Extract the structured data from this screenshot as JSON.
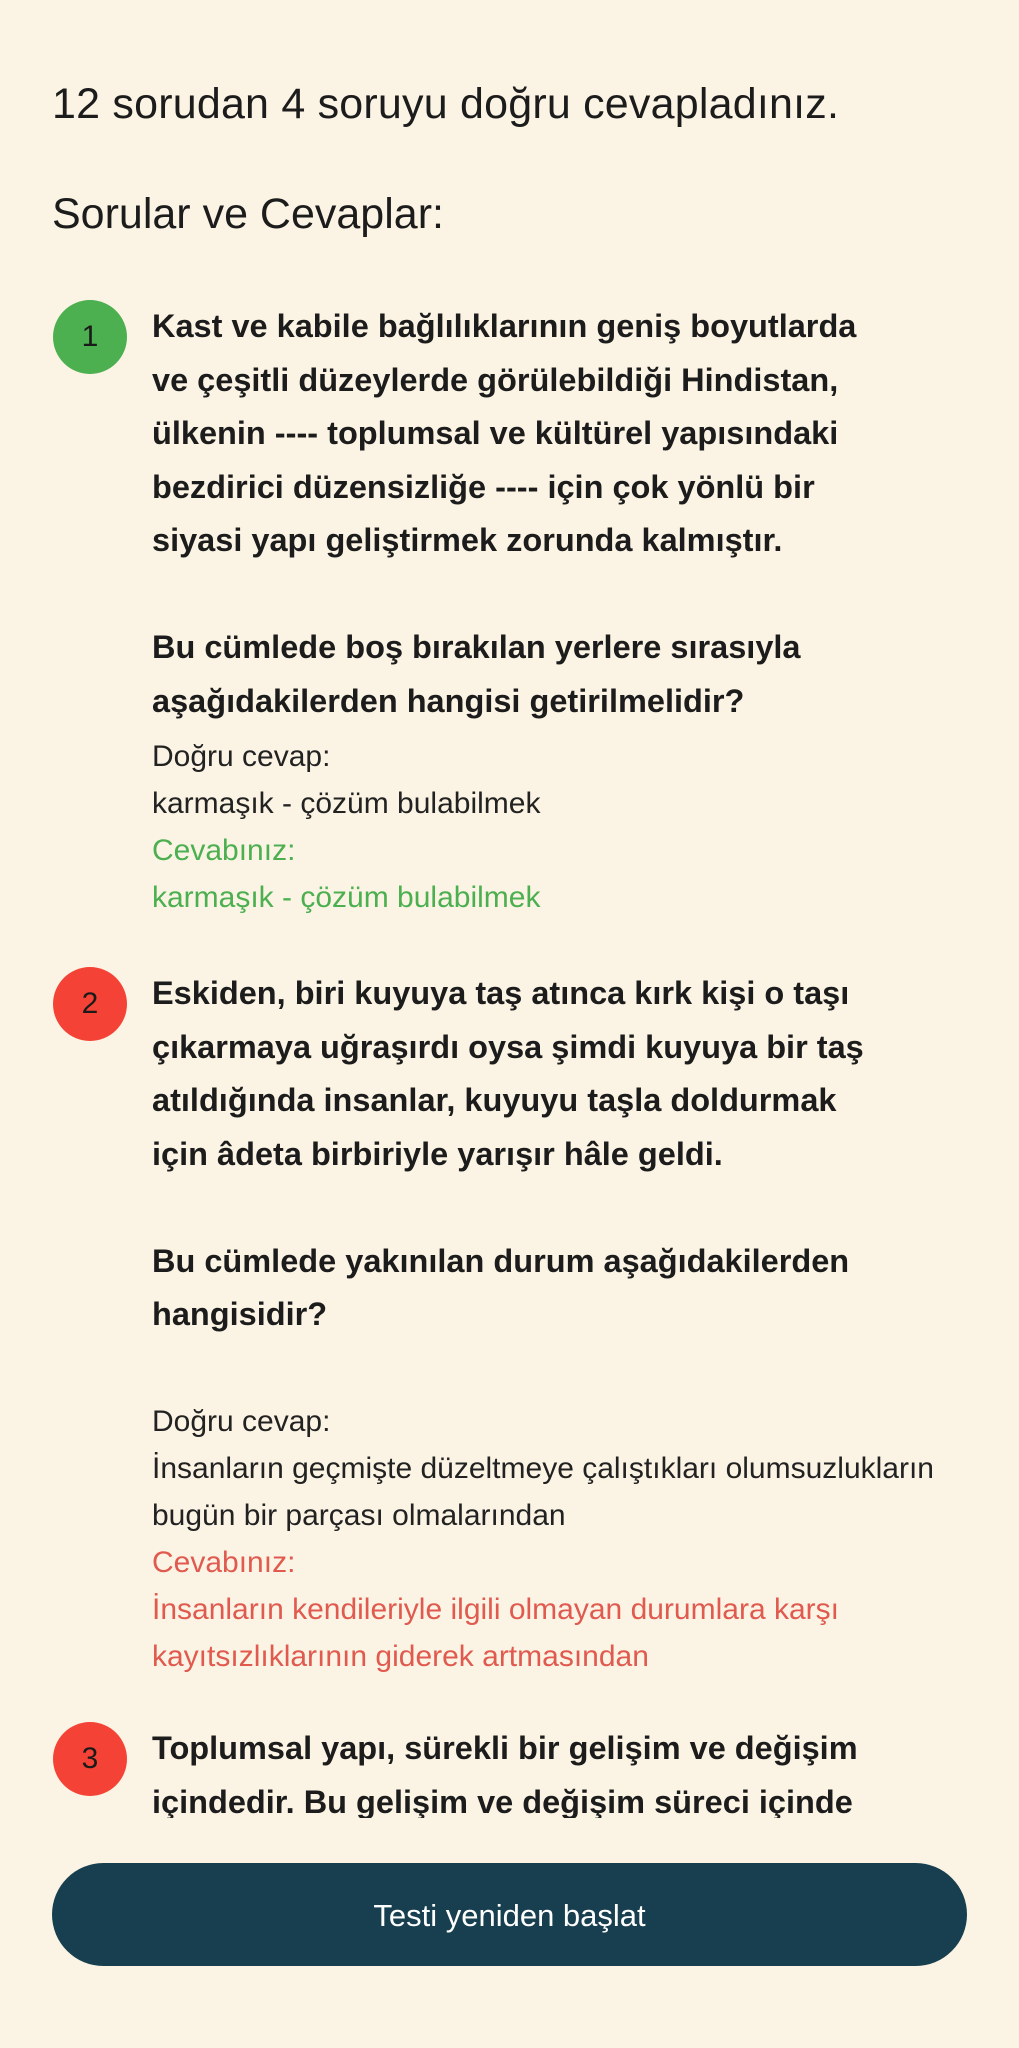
{
  "score_text": "12 sorudan 4 soruyu doğru cevapladınız.",
  "section_title": "Sorular ve Cevaplar:",
  "labels": {
    "correct_answer": "Doğru cevap:",
    "your_answer": "Cevabınız:"
  },
  "colors": {
    "background": "#fbf4e4",
    "correct": "#4caf50",
    "wrong": "#f44336",
    "wrong_text": "#e05a4f",
    "button": "#173f4f"
  },
  "questions": [
    {
      "number": "1",
      "status": "correct",
      "text": "Kast ve kabile bağlılıklarının geniş boyutlarda\nve çeşitli düzeylerde görülebildiği Hindistan,\nülkenin ---- toplumsal ve kültürel yapısındaki\nbezdirici düzensizliğe ---- için çok yönlü bir\nsiyasi yapı geliştirmek zorunda kalmıştır.\n\nBu cümlede boş bırakılan yerlere sırasıyla\naşağıdakilerden hangisi getirilmelidir?",
      "correct_answer": "karmaşık - çözüm bulabilmek",
      "your_answer": "karmaşık - çözüm bulabilmek"
    },
    {
      "number": "2",
      "status": "wrong",
      "text": "Eskiden, biri kuyuya taş atınca kırk kişi o taşı\nçıkarmaya uğraşırdı oysa şimdi kuyuya bir taş\natıldığında insanlar, kuyuyu taşla doldurmak\niçin âdeta birbiriyle yarışır hâle geldi.\n\nBu cümlede yakınılan durum aşağıdakilerden\nhangisidir?",
      "correct_answer": "İnsanların geçmişte düzeltmeye çalıştıkları olumsuzlukların bugün bir parçası olmalarından",
      "your_answer": "İnsanların kendileriyle ilgili olmayan durumlara karşı kayıtsızlıklarının giderek artmasından"
    },
    {
      "number": "3",
      "status": "wrong",
      "text": "Toplumsal yapı, sürekli bir gelişim ve değişim\niçindedir. Bu gelişim ve değişim süreci içinde"
    }
  ],
  "restart_button": "Testi yeniden başlat"
}
